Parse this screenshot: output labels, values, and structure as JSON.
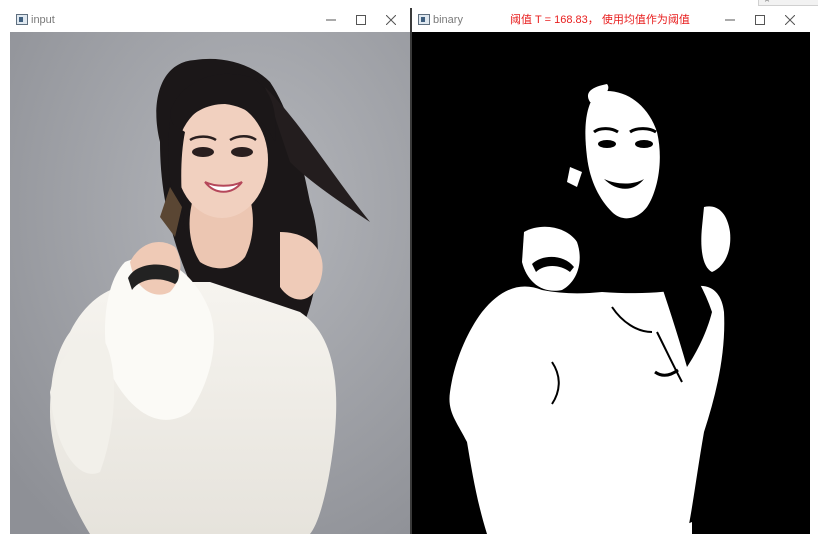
{
  "windows": {
    "input": {
      "title": "input"
    },
    "binary": {
      "title": "binary",
      "caption": "阈值 T = 168.83， 使用均值作为阈值"
    }
  },
  "icons": {
    "window_icon": "opencv-window-icon",
    "minimize": "minimize-icon",
    "maximize": "maximize-icon",
    "close": "close-icon"
  },
  "colors": {
    "caption_text": "#e81e1e",
    "binary_foreground": "#ffffff",
    "binary_background": "#000000"
  }
}
